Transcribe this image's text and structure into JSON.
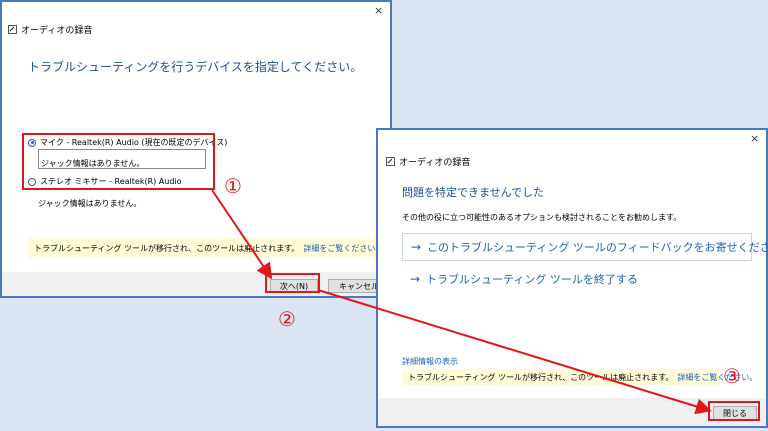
{
  "window1": {
    "title": "オーディオの録音",
    "close_glyph": "×",
    "heading": "トラブルシューティングを行うデバイスを指定してください。",
    "devices": [
      {
        "label": "マイク - Realtek(R) Audio (現在の既定のデバイス)",
        "status": "ジャック情報はありません。",
        "selected": true
      },
      {
        "label": "ステレオ ミキサー - Realtek(R) Audio",
        "status": "ジャック情報はありません。",
        "selected": false
      }
    ],
    "notice": "トラブルシューティング ツールが移行され、このツールは廃止されます。",
    "notice_link": "詳細をご覧ください。",
    "next_button": "次へ(N)",
    "cancel_button": "キャンセル"
  },
  "window2": {
    "title": "オーディオの録音",
    "close_glyph": "×",
    "heading": "問題を特定できませんでした",
    "subtext": "その他の役に立つ可能性のあるオプションも検討されることをお勧めします。",
    "options": [
      {
        "label": "このトラブルシューティング ツールのフィードバックをお寄せください"
      },
      {
        "label": "トラブルシューティング ツールを終了する"
      }
    ],
    "details_link": "詳細情報の表示",
    "notice": "トラブルシューティング ツールが移行され、このツールは廃止されます。",
    "notice_link": "詳細をご覧ください。",
    "close_button": "閉じる"
  },
  "annotations": {
    "step1": "①",
    "step2": "②",
    "step3": "③",
    "color": "#e0161b"
  },
  "icons": {
    "window_icon": "troubleshooter-window-icon",
    "option_arrow": "→"
  },
  "colors": {
    "heading": "#1f4e99",
    "link": "#1f5fb8",
    "window_border": "#4a78c2",
    "notice_bg": "#fffbd6",
    "annotation": "#e0161b"
  }
}
